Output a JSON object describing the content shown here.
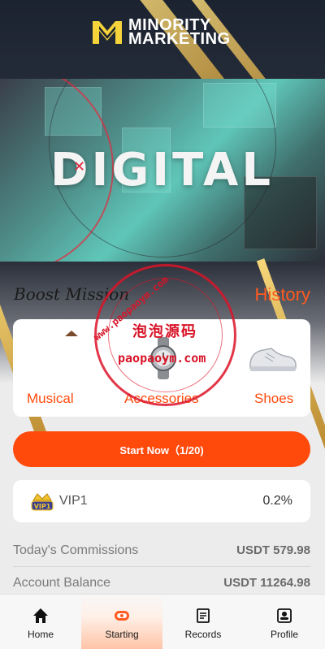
{
  "header": {
    "logo_line1": "MINORITY",
    "logo_line2": "MARKETING",
    "brand_color": "#f5d33b"
  },
  "banner": {
    "headline": "DIGITAL"
  },
  "mission": {
    "title": "Boost Mission",
    "history_label": "History"
  },
  "categories": [
    {
      "label": "Musical",
      "icon": "music-product-icon"
    },
    {
      "label": "Accessories",
      "icon": "watch-icon"
    },
    {
      "label": "Shoes",
      "icon": "sneaker-icon"
    }
  ],
  "start_button": {
    "label": "Start Now（1/20)"
  },
  "vip": {
    "label": "VIP1",
    "rate": "0.2%",
    "badge_text": "VIP1"
  },
  "stats": [
    {
      "label": "Today's Commissions",
      "value": "USDT 579.98"
    },
    {
      "label": "Account Balance",
      "value": "USDT 11264.98"
    }
  ],
  "watermark": {
    "cn_text": "泡泡源码",
    "url": "paopaoym.com",
    "arc_text": "www.paopaoym.com"
  },
  "nav": [
    {
      "label": "Home",
      "icon": "home-icon",
      "active": false
    },
    {
      "label": "Starting",
      "icon": "starting-icon",
      "active": true
    },
    {
      "label": "Records",
      "icon": "records-icon",
      "active": false
    },
    {
      "label": "Profile",
      "icon": "profile-icon",
      "active": false
    }
  ],
  "colors": {
    "accent": "#ff4a0c",
    "header_bg": "#1c2330",
    "page_bg": "#ececec"
  }
}
